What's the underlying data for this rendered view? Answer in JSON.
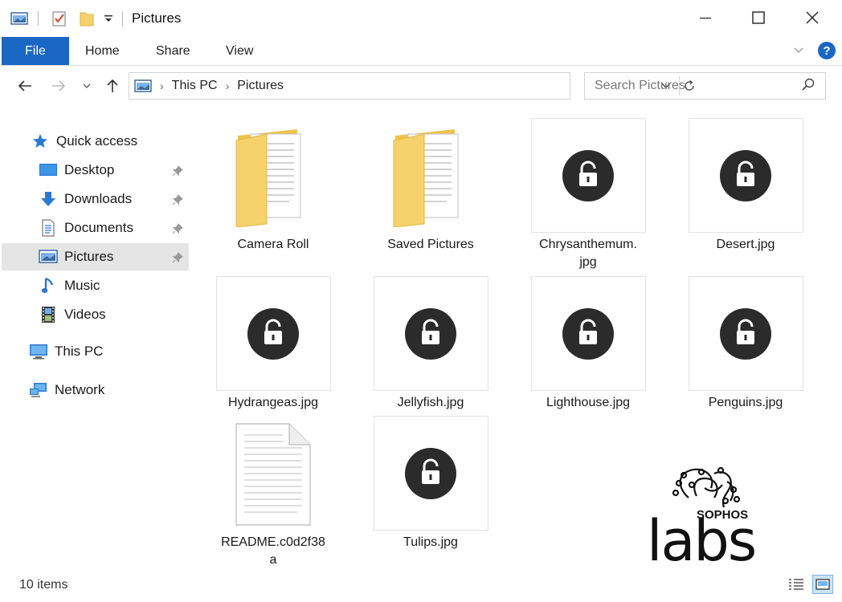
{
  "window": {
    "title": "Pictures"
  },
  "ribbon": {
    "tabs": [
      "File",
      "Home",
      "Share",
      "View"
    ],
    "help_label": "?"
  },
  "address": {
    "crumbs": [
      "This PC",
      "Pictures"
    ],
    "search_placeholder": "Search Pictures"
  },
  "sidebar": {
    "items": [
      {
        "label": "Quick access",
        "icon": "star-icon"
      },
      {
        "label": "Desktop",
        "icon": "desktop-icon",
        "pinned": true
      },
      {
        "label": "Downloads",
        "icon": "download-arrow-icon",
        "pinned": true
      },
      {
        "label": "Documents",
        "icon": "document-icon",
        "pinned": true
      },
      {
        "label": "Pictures",
        "icon": "pictures-icon",
        "pinned": true,
        "selected": true
      },
      {
        "label": "Music",
        "icon": "music-note-icon"
      },
      {
        "label": "Videos",
        "icon": "film-icon"
      },
      {
        "label": "This PC",
        "icon": "computer-icon"
      },
      {
        "label": "Network",
        "icon": "network-icon"
      }
    ]
  },
  "files": [
    {
      "name": "Camera Roll",
      "type": "folder"
    },
    {
      "name": "Saved Pictures",
      "type": "folder"
    },
    {
      "name": "Chrysanthemum.\njpg",
      "type": "locked"
    },
    {
      "name": "Desert.jpg",
      "type": "locked"
    },
    {
      "name": "Hydrangeas.jpg",
      "type": "locked"
    },
    {
      "name": "Jellyfish.jpg",
      "type": "locked"
    },
    {
      "name": "Lighthouse.jpg",
      "type": "locked"
    },
    {
      "name": "Penguins.jpg",
      "type": "locked"
    },
    {
      "name": "README.c0d2f38\na",
      "type": "text"
    },
    {
      "name": "Tulips.jpg",
      "type": "locked"
    }
  ],
  "status": {
    "item_count": "10 items"
  },
  "watermark": {
    "brand_small": "SOPHOS",
    "brand_large": "labs"
  },
  "colors": {
    "accent": "#1a66c4",
    "selected_bg": "#e5e5e5",
    "lock_circle": "#2b2b2b",
    "folder": "#f5d26c"
  }
}
